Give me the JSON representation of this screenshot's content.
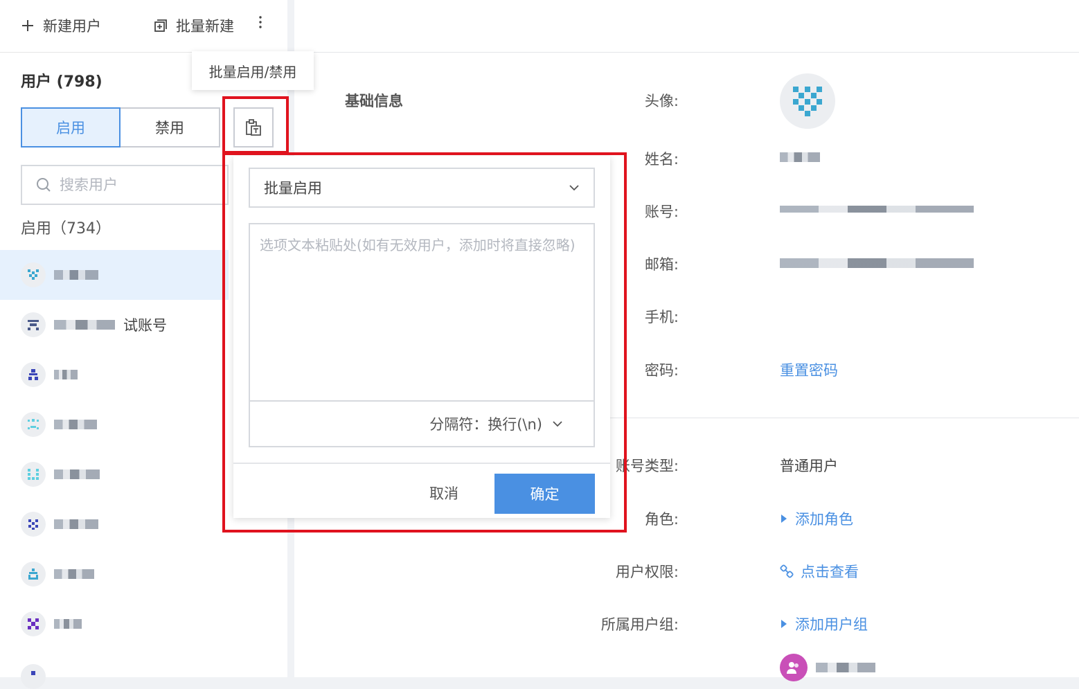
{
  "toolbar": {
    "new_user": "新建用户",
    "batch_create": "批量新建",
    "more_icon": "more-vertical-icon"
  },
  "sidebar": {
    "title": "用户 (798)",
    "tabs": [
      "启用",
      "禁用"
    ],
    "search_placeholder": "搜索用户",
    "count_label": "启用（734）",
    "items": [
      {
        "suffix": ""
      },
      {
        "suffix": "试账号"
      },
      {
        "suffix": ""
      },
      {
        "suffix": ""
      },
      {
        "suffix": ""
      },
      {
        "suffix": ""
      },
      {
        "suffix": ""
      },
      {
        "suffix": ""
      }
    ]
  },
  "tooltip": "批量启用/禁用",
  "popup": {
    "select_value": "批量启用",
    "textarea_placeholder": "选项文本粘贴处(如有无效用户，添加时将直接忽略)",
    "separator_label": "分隔符：换行(\\n)",
    "cancel": "取消",
    "confirm": "确定"
  },
  "detail": {
    "section_title": "基础信息",
    "labels": {
      "avatar": "头像:",
      "name": "姓名:",
      "account": "账号:",
      "email": "邮箱:",
      "phone": "手机:",
      "password": "密码:",
      "account_type": "账号类型:",
      "role": "角色:",
      "permissions": "用户权限:",
      "groups": "所属用户组:"
    },
    "values": {
      "reset_password": "重置密码",
      "account_type": "普通用户",
      "add_role": "添加角色",
      "view_permissions": "点击查看",
      "add_group": "添加用户组"
    }
  },
  "colors": {
    "accent": "#4a90e2",
    "highlight": "#e0131e"
  }
}
